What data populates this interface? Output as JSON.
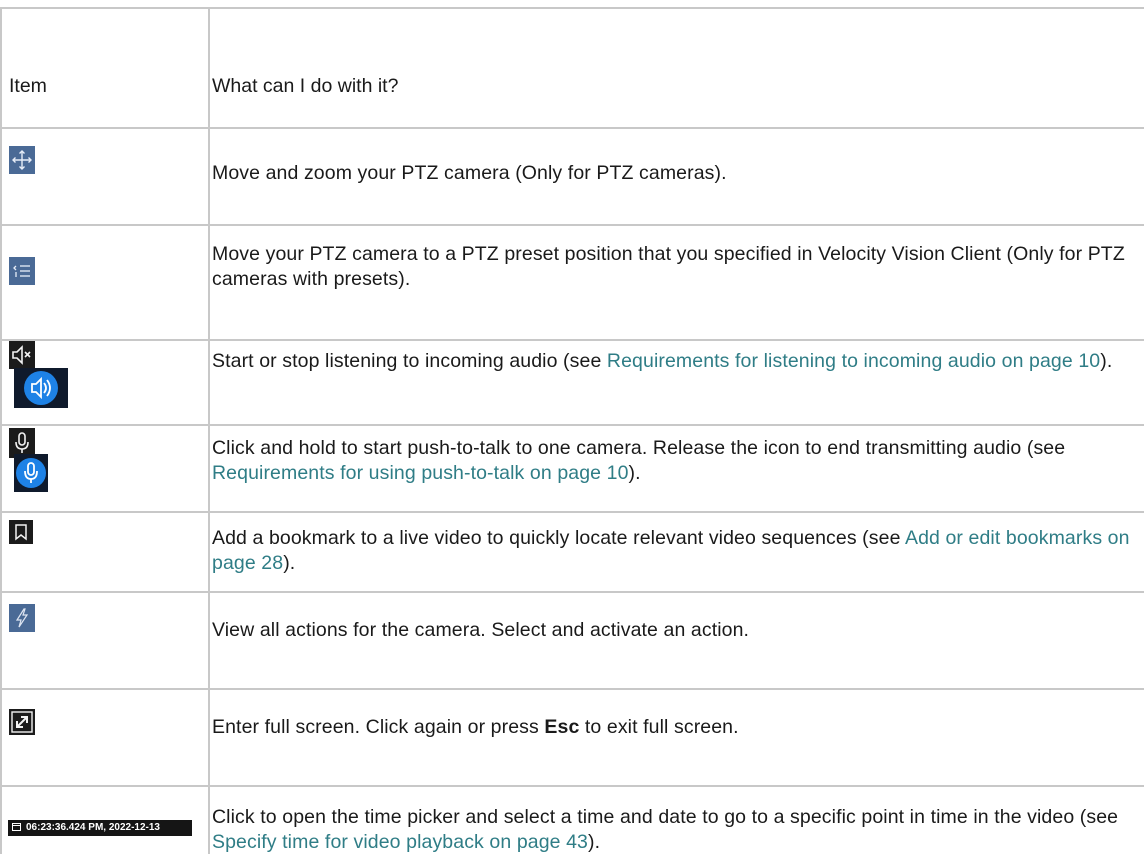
{
  "header": {
    "col_item": "Item",
    "col_desc": "What can I do with it?"
  },
  "rows": [
    {
      "icon": "ptz-move-icon",
      "desc": "Move and zoom your PTZ camera (Only for PTZ cameras)."
    },
    {
      "icon": "ptz-preset-icon",
      "desc": "Move your PTZ camera to a PTZ preset position that you specified in Velocity Vision Client (Only for PTZ cameras with presets)."
    },
    {
      "icon": "speaker-icon",
      "desc_before": "Start or stop listening to incoming audio (see ",
      "link": "Requirements for listening to incoming audio on page 10",
      "desc_after": ")."
    },
    {
      "icon": "microphone-icon",
      "desc_before": "Click and hold to start push-to-talk to one camera. Release the icon to end transmitting audio (see ",
      "link": "Requirements for using push-to-talk on page 10",
      "desc_after": ")."
    },
    {
      "icon": "bookmark-icon",
      "desc_before": "Add a bookmark to a live video to quickly locate relevant video sequences (see ",
      "link": "Add or edit bookmarks on page 28",
      "desc_after": ")."
    },
    {
      "icon": "lightning-icon",
      "desc": "View all actions for the camera. Select and activate an action."
    },
    {
      "icon": "fullscreen-icon",
      "desc_before": "Enter full screen. Click again or press ",
      "key": "Esc",
      "desc_after": " to exit full screen."
    },
    {
      "icon": "clock-icon",
      "timestamp": "06:23:36.424 PM, 2022-12-13",
      "desc_before": "Click to open the time picker and select a time and date to go to a specific point in time in the video (see ",
      "link": "Specify time for video playback on page 43",
      "desc_after": ")."
    }
  ],
  "colors": {
    "link": "#2f7d86",
    "grid": "#c8c8c8"
  }
}
